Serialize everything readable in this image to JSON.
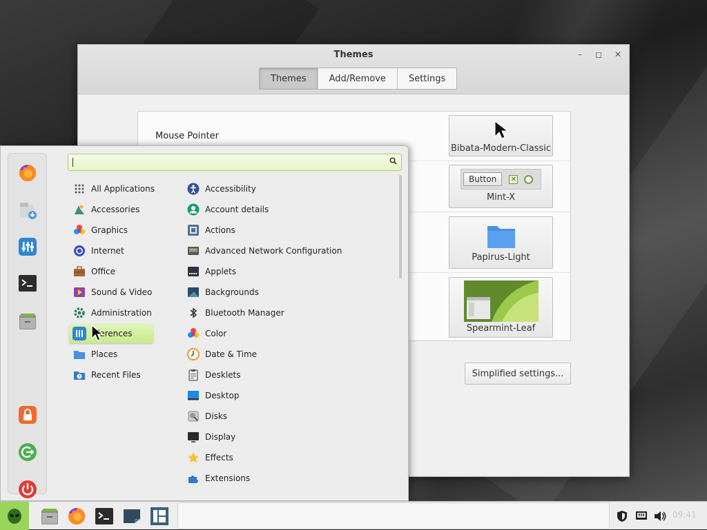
{
  "window": {
    "title": "Themes",
    "controls": {
      "minimize": "–",
      "maximize": "◻",
      "close": "✕"
    },
    "tabs": [
      {
        "label": "Themes",
        "active": true
      },
      {
        "label": "Add/Remove",
        "active": false
      },
      {
        "label": "Settings",
        "active": false
      }
    ],
    "rows": [
      {
        "label": "Mouse Pointer",
        "value": "Bibata-Modern-Classic"
      },
      {
        "label": "",
        "value": "Mint-X",
        "preview_button": "Button"
      },
      {
        "label": "",
        "value": "Papirus-Light"
      },
      {
        "label": "",
        "value": "Spearmint-Leaf"
      }
    ],
    "simplified_button": "Simplified settings..."
  },
  "menu": {
    "search": {
      "value": "",
      "placeholder": ""
    },
    "favorites": [
      "firefox-icon",
      "software-manager-icon",
      "system-settings-icon",
      "terminal-icon",
      "files-icon"
    ],
    "session": [
      "lock-icon",
      "logout-icon",
      "power-icon"
    ],
    "categories": [
      {
        "label": "All Applications",
        "icon": "grid-icon"
      },
      {
        "label": "Accessories",
        "icon": "accessories-icon"
      },
      {
        "label": "Graphics",
        "icon": "graphics-icon"
      },
      {
        "label": "Internet",
        "icon": "internet-icon"
      },
      {
        "label": "Office",
        "icon": "office-icon"
      },
      {
        "label": "Sound & Video",
        "icon": "sound-video-icon"
      },
      {
        "label": "Administration",
        "icon": "administration-icon"
      },
      {
        "label": "ferences",
        "icon": "preferences-icon",
        "selected": true
      },
      {
        "label": "Places",
        "icon": "places-icon"
      },
      {
        "label": "Recent Files",
        "icon": "recent-files-icon"
      }
    ],
    "apps": [
      {
        "label": "Accessibility",
        "icon": "accessibility-icon"
      },
      {
        "label": "Account details",
        "icon": "account-icon"
      },
      {
        "label": "Actions",
        "icon": "actions-icon"
      },
      {
        "label": "Advanced Network Configuration",
        "icon": "network-icon"
      },
      {
        "label": "Applets",
        "icon": "applets-icon"
      },
      {
        "label": "Backgrounds",
        "icon": "backgrounds-icon"
      },
      {
        "label": "Bluetooth Manager",
        "icon": "bluetooth-icon"
      },
      {
        "label": "Color",
        "icon": "color-icon"
      },
      {
        "label": "Date & Time",
        "icon": "clock-icon"
      },
      {
        "label": "Desklets",
        "icon": "desklets-icon"
      },
      {
        "label": "Desktop",
        "icon": "desktop-icon"
      },
      {
        "label": "Disks",
        "icon": "disks-icon"
      },
      {
        "label": "Display",
        "icon": "display-icon"
      },
      {
        "label": "Effects",
        "icon": "effects-icon"
      },
      {
        "label": "Extensions",
        "icon": "extensions-icon"
      }
    ]
  },
  "taskbar": {
    "launchers": [
      "mint-menu-icon",
      "files-icon",
      "firefox-icon",
      "terminal-icon",
      "workspace-icon",
      "window-list-icon"
    ],
    "tray": [
      "shield-icon",
      "network-icon",
      "volume-icon"
    ],
    "clock": "09:41"
  }
}
